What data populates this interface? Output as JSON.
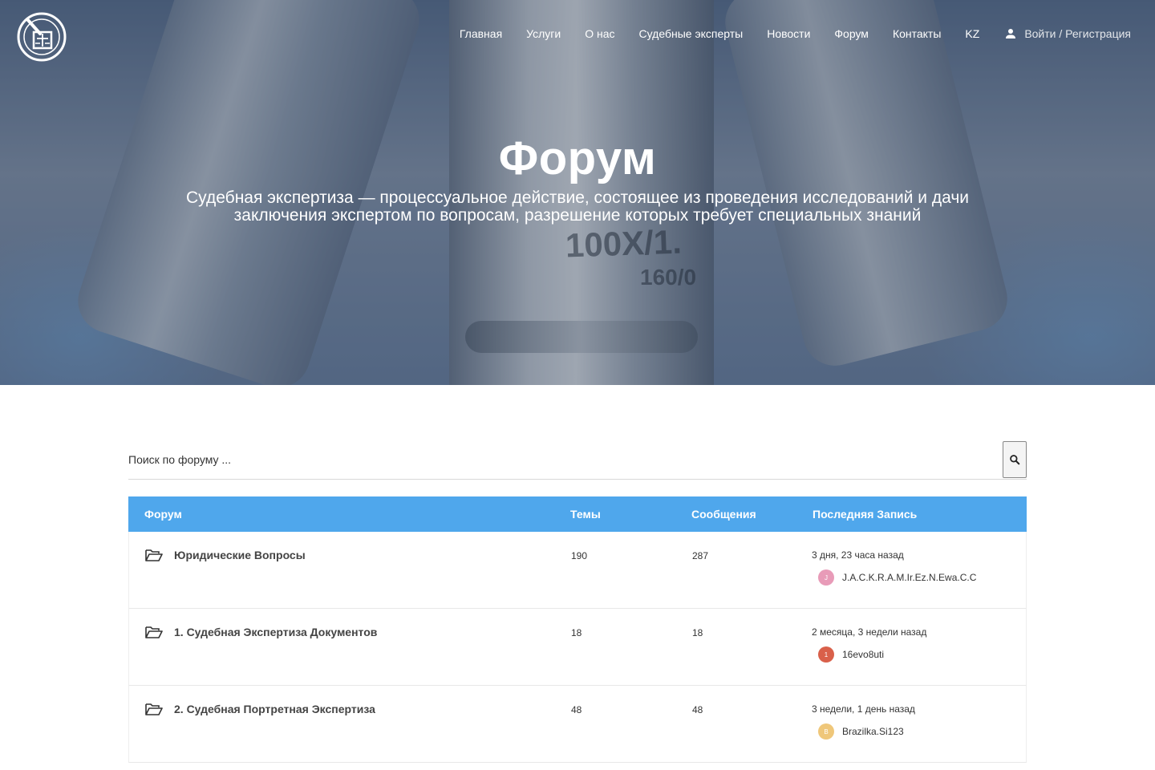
{
  "nav": {
    "items": [
      "Главная",
      "Услуги",
      "О нас",
      "Судебные эксперты",
      "Новости",
      "Форум",
      "Контакты",
      "KZ"
    ],
    "login_label": "Войти / Регистрация"
  },
  "hero": {
    "title": "Форум",
    "subtitle_line1": "Судебная экспертиза — процессуальное действие, состоящее из проведения исследований и дачи",
    "subtitle_line2": "заключения экспертом по вопросам, разрешение которых требует специальных знаний",
    "lens_marks": [
      "100X/1.",
      "160/0"
    ]
  },
  "search": {
    "placeholder": "Поиск по форуму ...",
    "icon": "search-icon"
  },
  "table": {
    "headers": {
      "forum": "Форум",
      "topics": "Темы",
      "posts": "Сообщения",
      "last": "Последняя Запись"
    },
    "rows": [
      {
        "name": "Юридические Вопросы",
        "topics": "190",
        "posts": "287",
        "last_time": "3 дня, 23 часа назад",
        "last_user": "J.A.C.K.R.A.M.Ir.Ez.N.Ewa.C.C",
        "avatar_letter": "J",
        "avatar_color": "#e89bb8"
      },
      {
        "name": "1. Судебная Экспертиза Документов",
        "topics": "18",
        "posts": "18",
        "last_time": "2 месяца, 3 недели назад",
        "last_user": "16evo8uti",
        "avatar_letter": "1",
        "avatar_color": "#d9604a"
      },
      {
        "name": "2. Судебная Портретная Экспертиза",
        "topics": "48",
        "posts": "48",
        "last_time": "3 недели, 1 день назад",
        "last_user": "Brazilka.Si123",
        "avatar_letter": "B",
        "avatar_color": "#efc77a"
      }
    ]
  },
  "colors": {
    "header_bg": "#4fa7ec",
    "hero_overlay": "#2d4566"
  }
}
